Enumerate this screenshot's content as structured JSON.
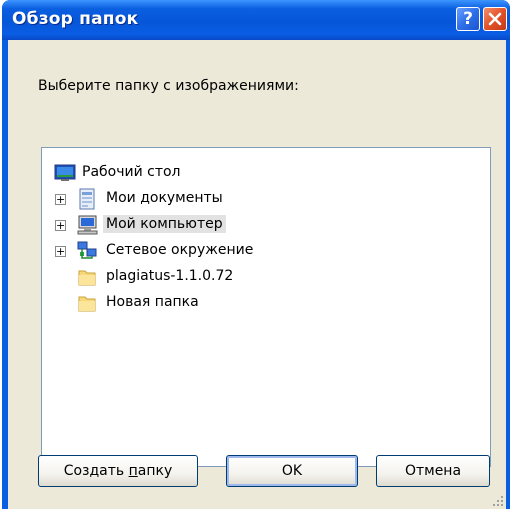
{
  "window": {
    "title": "Обзор папок",
    "help_label": "?",
    "close_label": "✕"
  },
  "prompt": "Выберите папку с изображениями:",
  "tree": {
    "items": [
      {
        "label": "Рабочий стол",
        "icon": "desktop-icon",
        "expandable": false,
        "selected": false
      },
      {
        "label": "Мои документы",
        "icon": "my-documents-icon",
        "expandable": true,
        "selected": false
      },
      {
        "label": "Мой компьютер",
        "icon": "my-computer-icon",
        "expandable": true,
        "selected": true
      },
      {
        "label": "Сетевое окружение",
        "icon": "network-icon",
        "expandable": true,
        "selected": false
      },
      {
        "label": "plagiatus-1.1.0.72",
        "icon": "folder-icon",
        "expandable": false,
        "selected": false
      },
      {
        "label": "Новая папка",
        "icon": "folder-icon",
        "expandable": false,
        "selected": false
      }
    ]
  },
  "buttons": {
    "create_prefix": "Создать ",
    "create_underlined": "п",
    "create_suffix": "апку",
    "ok": "OK",
    "cancel": "Отмена"
  },
  "colors": {
    "titlebar": "#0a5ee0",
    "dialog_face": "#ece9d8",
    "close_button": "#e3522a",
    "selection": "#e2e2e2"
  }
}
